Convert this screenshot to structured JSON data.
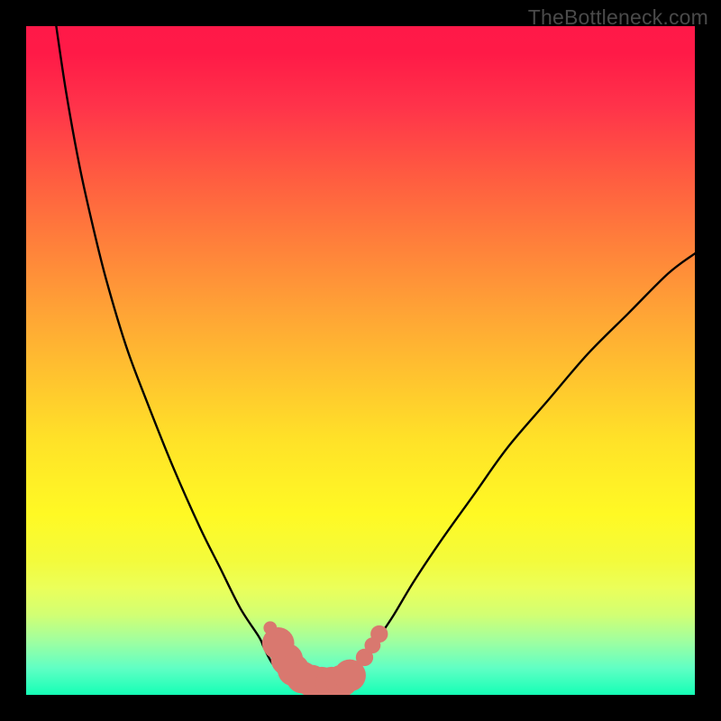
{
  "watermark": "TheBottleneck.com",
  "chart_data": {
    "type": "line",
    "title": "",
    "xlabel": "",
    "ylabel": "",
    "xlim": [
      0,
      100
    ],
    "ylim": [
      0,
      100
    ],
    "series": [
      {
        "name": "left-curve",
        "x": [
          4.5,
          6,
          8,
          10,
          12,
          15,
          18,
          22,
          26,
          29,
          32,
          34.8,
          35.5,
          36.5,
          37.7,
          39,
          41,
          43.5
        ],
        "y": [
          100,
          90,
          79,
          70,
          62,
          52,
          44,
          34,
          25,
          19,
          13,
          8.7,
          7.2,
          5.2,
          3.5,
          2.3,
          1.6,
          1.4
        ]
      },
      {
        "name": "valley-floor",
        "x": [
          43.5,
          45,
          46.5
        ],
        "y": [
          1.4,
          1.3,
          1.4
        ]
      },
      {
        "name": "right-curve",
        "x": [
          46.5,
          48,
          49.2,
          50.5,
          51.7,
          53,
          55,
          58,
          62,
          67,
          72,
          78,
          84,
          90,
          96,
          100
        ],
        "y": [
          1.4,
          1.9,
          3.4,
          5.4,
          7.2,
          9.0,
          12,
          17,
          23,
          30,
          37,
          44,
          51,
          57,
          63,
          66
        ]
      }
    ],
    "markers": [
      {
        "x": 36.5,
        "y": 10.0,
        "r": 1.0
      },
      {
        "x": 37.7,
        "y": 7.7,
        "r": 2.4
      },
      {
        "x": 39.0,
        "y": 5.3,
        "r": 2.4
      },
      {
        "x": 40.0,
        "y": 3.7,
        "r": 2.4
      },
      {
        "x": 41.3,
        "y": 2.6,
        "r": 2.4
      },
      {
        "x": 42.7,
        "y": 2.1,
        "r": 2.4
      },
      {
        "x": 44.2,
        "y": 1.8,
        "r": 2.4
      },
      {
        "x": 45.7,
        "y": 1.8,
        "r": 2.4
      },
      {
        "x": 47.2,
        "y": 2.1,
        "r": 2.4
      },
      {
        "x": 48.4,
        "y": 2.9,
        "r": 2.4
      },
      {
        "x": 50.6,
        "y": 5.6,
        "r": 1.3
      },
      {
        "x": 51.8,
        "y": 7.4,
        "r": 1.2
      },
      {
        "x": 52.8,
        "y": 9.1,
        "r": 1.3
      }
    ],
    "colors": {
      "curve": "#000000",
      "marker": "#d9786f",
      "bg_top": "#ff1948",
      "bg_mid": "#ffe228",
      "bg_bottom": "#15ffb6"
    }
  }
}
